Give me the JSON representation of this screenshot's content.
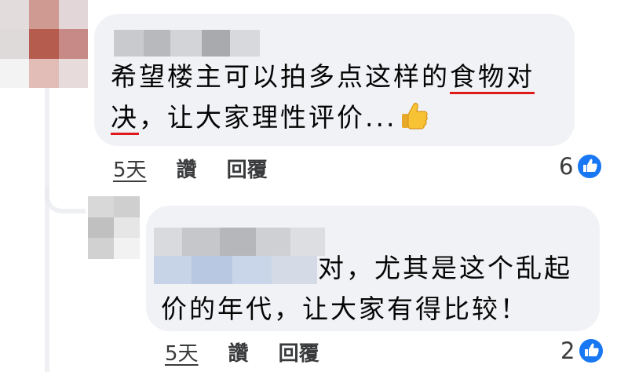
{
  "colors": {
    "bubble_bg": "#f0f2f5",
    "text": "#050505",
    "meta_text": "#3a3b3c",
    "like_blue": "#1877f2",
    "underline_red": "#e0191b"
  },
  "comments": [
    {
      "line1_pre": "希望楼主可以拍多点这样的",
      "line1_underlined": "食物对",
      "line2_underlined": "决",
      "line2_post": "，让大家理性评价...",
      "emoji": "thumbs-up-icon",
      "time": "5天",
      "like_label": "讚",
      "reply_label": "回覆",
      "reaction_count": "6",
      "reaction_icon": "like-icon"
    },
    {
      "line1": "对，尤其是这个乱起",
      "line2": "价的年代，让大家有得比较！",
      "time": "5天",
      "like_label": "讚",
      "reply_label": "回覆",
      "reaction_count": "2",
      "reaction_icon": "like-icon"
    }
  ]
}
